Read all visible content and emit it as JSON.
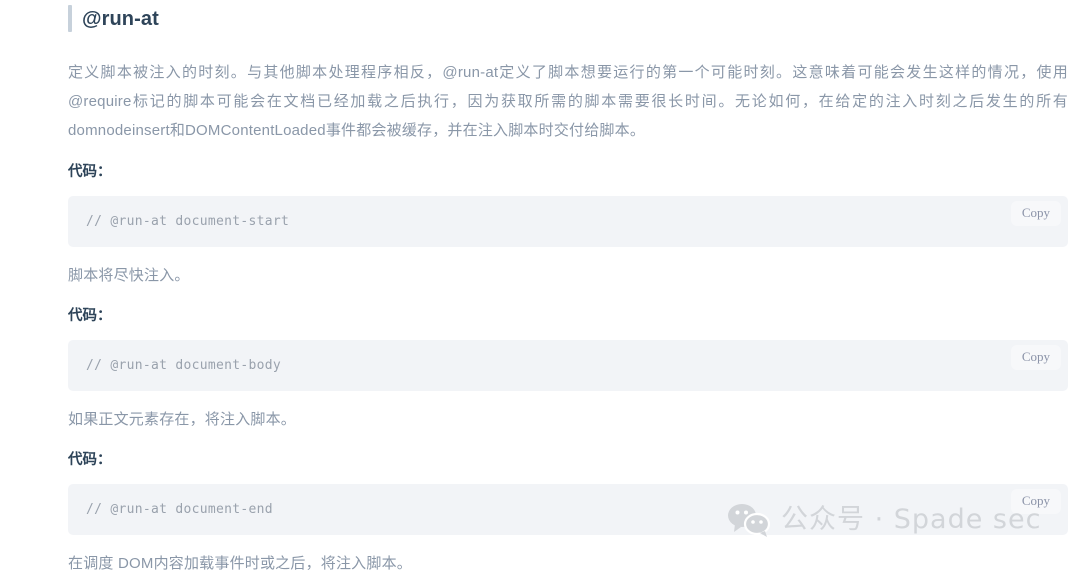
{
  "page": {
    "heading": "@run-at",
    "intro_paragraph": "定义脚本被注入的时刻。与其他脚本处理程序相反，@run-at定义了脚本想要运行的第一个可能时刻。这意味着可能会发生这样的情况，使用@require标记的脚本可能会在文档已经加载之后执行，因为获取所需的脚本需要很长时间。无论如何，在给定的注入时刻之后发生的所有domnodeinsert和DOMContentLoaded事件都会被缓存，并在注入脚本时交付给脚本。"
  },
  "sections": [
    {
      "label": "代码：",
      "code": "// @run-at document-start",
      "copy_label": "Copy",
      "note": "脚本将尽快注入。"
    },
    {
      "label": "代码：",
      "code": "// @run-at document-body",
      "copy_label": "Copy",
      "note": "如果正文元素存在，将注入脚本。"
    },
    {
      "label": "代码：",
      "code": "// @run-at document-end",
      "copy_label": "Copy",
      "note": "在调度 DOM内容加载事件时或之后，将注入脚本。"
    }
  ],
  "watermark": {
    "icon": "wechat-icon",
    "text": "公众号 · Spade sec",
    "color": "#d2d5d9"
  },
  "colors": {
    "heading_text": "#2e4459",
    "accent_bar": "#c7d1db",
    "body_text": "#8a97a8",
    "code_background": "#f2f4f7",
    "code_text": "#9aa2ad",
    "copy_background": "#f7f8fa",
    "copy_text": "#8b93a8",
    "page_background": "#ffffff"
  }
}
